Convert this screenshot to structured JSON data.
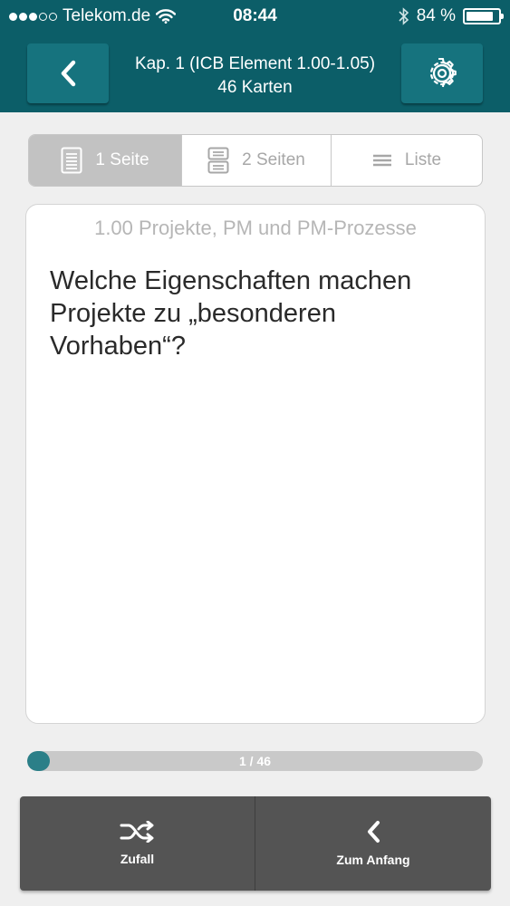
{
  "status_bar": {
    "carrier": "Telekom.de",
    "time": "08:44",
    "battery": "84 %",
    "battery_level": 0.84
  },
  "header": {
    "title": "Kap. 1 (ICB Element 1.00-1.05)",
    "subtitle": "46 Karten",
    "back_icon": "chevron-left-icon",
    "settings_icon": "gear-icon"
  },
  "view_modes": [
    {
      "label": "1 Seite",
      "icon": "single-page-icon",
      "selected": true
    },
    {
      "label": "2 Seiten",
      "icon": "two-pages-icon",
      "selected": false
    },
    {
      "label": "Liste",
      "icon": "list-icon",
      "selected": false
    }
  ],
  "card": {
    "subtitle": "1.00 Projekte, PM und PM-Prozesse",
    "question": "Welche Eigenschaften machen Projekte zu „besonderen Vorhaben“?"
  },
  "progress": {
    "label": "1 / 46",
    "current": 1,
    "total": 46
  },
  "bottom_bar": {
    "shuffle_label": "Zufall",
    "restart_label": "Zum Anfang"
  },
  "colors": {
    "header_bg": "#0c5e68",
    "button_bg": "#16737e",
    "progress_fill": "#2b7f88",
    "bottom_bar_bg": "#545454"
  }
}
